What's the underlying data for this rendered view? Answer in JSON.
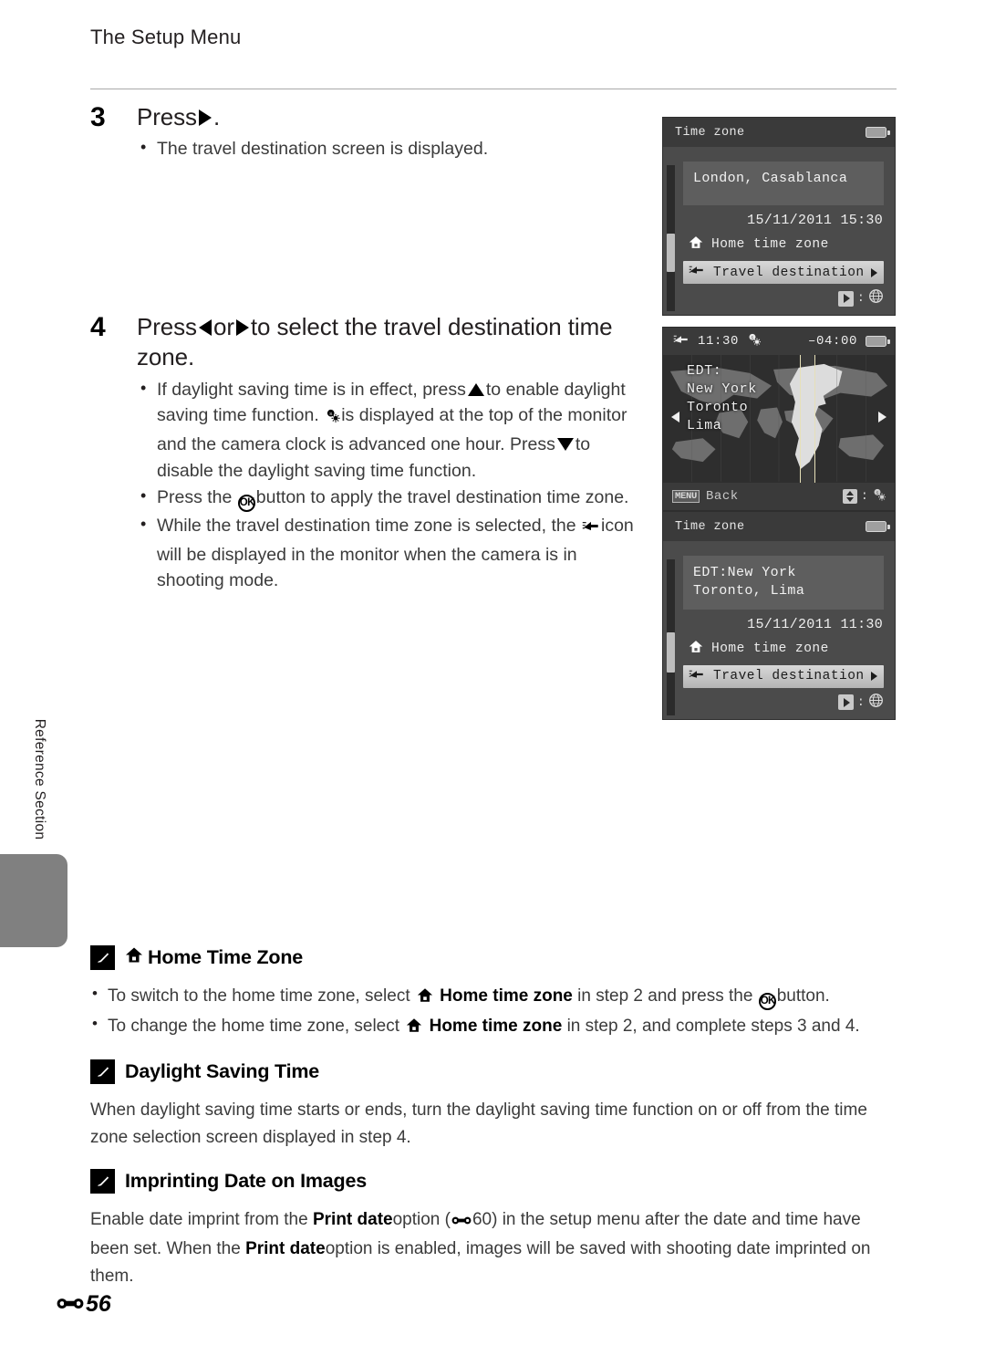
{
  "page": {
    "header": "The Setup Menu",
    "side_tab_label": "Reference Section",
    "folio_number": "56"
  },
  "steps": [
    {
      "number": "3",
      "title_prefix": "Press",
      "title_suffix": ".",
      "title_icon": "right-arrow-triangle",
      "bullets": [
        {
          "text": "The travel destination screen is displayed."
        }
      ]
    },
    {
      "number": "4",
      "title_part1": "Press",
      "title_part2": "or",
      "title_part3": "to select the travel destination time zone.",
      "bullets": [
        {
          "p1": "If daylight saving time is in effect, press",
          "p2": "to enable daylight saving time function.",
          "p3": "is displayed at the top of the monitor and the camera clock is advanced one hour. Press",
          "p4": "to disable the daylight saving time function."
        },
        {
          "p1": "Press the",
          "p2": "button to apply the travel destination time zone."
        },
        {
          "p1": "While the travel destination time zone is selected, the",
          "p2": "icon will be displayed in the monitor when the camera is in shooting mode."
        }
      ]
    }
  ],
  "notes": [
    {
      "id": "home-time-zone",
      "title": "Home Time Zone",
      "title_icon": "house-icon",
      "bullets": [
        {
          "p1": "To switch to the home time zone, select",
          "bold": "Home time zone",
          "p2": "in step 2 and press the",
          "p3": "button."
        },
        {
          "p1": "To change the home time zone, select",
          "bold": "Home time zone",
          "p2": "in step 2, and complete steps 3 and 4."
        }
      ]
    },
    {
      "id": "daylight-saving-time",
      "title": "Daylight Saving Time",
      "paragraph": "When daylight saving time starts or ends, turn the daylight saving time function on or off from the time zone selection screen displayed in step 4."
    },
    {
      "id": "imprinting-date-on-images",
      "title": "Imprinting Date on Images",
      "para_p1": "Enable date imprint from the",
      "para_b1": "Print date",
      "para_p2": "option (",
      "para_ref": "60",
      "para_p3": ") in the setup menu after the date and time have been set. When the",
      "para_b2": "Print date",
      "para_p4": "option is enabled, images will be saved with shooting date imprinted on them."
    }
  ],
  "screens": [
    {
      "id": "timezone-home",
      "title": "Time zone",
      "zone_line1": "London, Casablanca",
      "zone_line2": "",
      "datetime": "15/11/2011 15:30",
      "option_home": "Home time zone",
      "option_travel": "Travel destination",
      "foot_glyph": "globe-icon"
    },
    {
      "id": "world-map",
      "top_time": "11:30",
      "top_offset": "–04:00",
      "map_line1": "EDT:",
      "map_line2": "New York",
      "map_line3": "Toronto",
      "map_line4": "Lima",
      "menu_chip": "MENU",
      "menu_label": "Back"
    },
    {
      "id": "timezone-travel",
      "title": "Time zone",
      "zone_line1": "EDT:New York",
      "zone_line2": "Toronto, Lima",
      "datetime": "15/11/2011 11:30",
      "option_home": "Home time zone",
      "option_travel": "Travel destination",
      "foot_glyph": "globe-icon"
    }
  ],
  "colors": {
    "tab_gray": "#808080",
    "rule_gray": "#a9a9a9",
    "text": "#231f20",
    "body_text": "#3b3b3b"
  }
}
